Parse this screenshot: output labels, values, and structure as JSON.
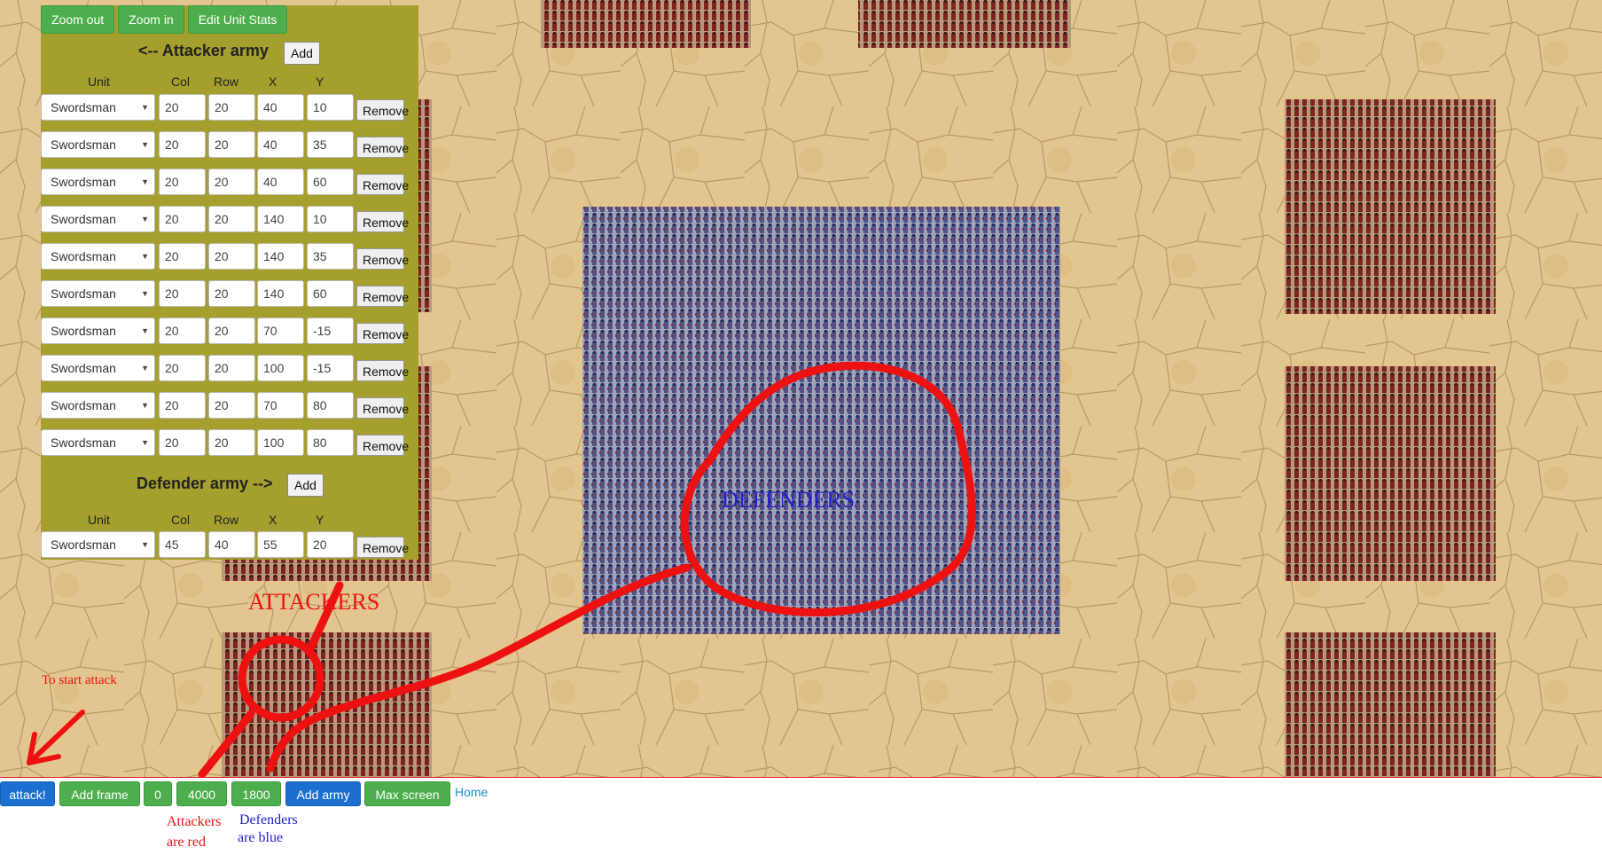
{
  "panel": {
    "zoom_out": "Zoom out",
    "zoom_in": "Zoom in",
    "edit_unit_stats": "Edit Unit Stats",
    "attacker_title": "<-- Attacker army",
    "defender_title": "Defender army -->",
    "add_label": "Add",
    "remove_label": "Remove",
    "columns": [
      "Unit",
      "Col",
      "Row",
      "X",
      "Y"
    ],
    "attackers": [
      {
        "unit": "Swordsman",
        "col": "20",
        "row": "20",
        "x": "40",
        "y": "10"
      },
      {
        "unit": "Swordsman",
        "col": "20",
        "row": "20",
        "x": "40",
        "y": "35"
      },
      {
        "unit": "Swordsman",
        "col": "20",
        "row": "20",
        "x": "40",
        "y": "60"
      },
      {
        "unit": "Swordsman",
        "col": "20",
        "row": "20",
        "x": "140",
        "y": "10"
      },
      {
        "unit": "Swordsman",
        "col": "20",
        "row": "20",
        "x": "140",
        "y": "35"
      },
      {
        "unit": "Swordsman",
        "col": "20",
        "row": "20",
        "x": "140",
        "y": "60"
      },
      {
        "unit": "Swordsman",
        "col": "20",
        "row": "20",
        "x": "70",
        "y": "-15"
      },
      {
        "unit": "Swordsman",
        "col": "20",
        "row": "20",
        "x": "100",
        "y": "-15"
      },
      {
        "unit": "Swordsman",
        "col": "20",
        "row": "20",
        "x": "70",
        "y": "80"
      },
      {
        "unit": "Swordsman",
        "col": "20",
        "row": "20",
        "x": "100",
        "y": "80"
      }
    ],
    "defenders": [
      {
        "unit": "Swordsman",
        "col": "45",
        "row": "40",
        "x": "55",
        "y": "20"
      }
    ]
  },
  "bottombar": {
    "attack": "attack!",
    "add_frame": "Add frame",
    "frame": "0",
    "width": "4000",
    "height": "1800",
    "add_army": "Add army",
    "max_screen": "Max screen",
    "home": "Home"
  },
  "annotations": {
    "attackers": "ATTACKERS",
    "defenders": "DEFENDERS",
    "to_start": "To start attack",
    "attackers_red_1": "Attackers",
    "attackers_red_2": "are red",
    "defenders_blue_1": "Defenders",
    "defenders_blue_2": "are blue"
  },
  "colors": {
    "sand": "#e2c48e",
    "attacker_red": "#8a2a2a",
    "defender_blue": "#5a5f8c",
    "panel": "#a59f2d",
    "annotation_red": "#ee1111",
    "annotation_blue": "#2222cc"
  }
}
